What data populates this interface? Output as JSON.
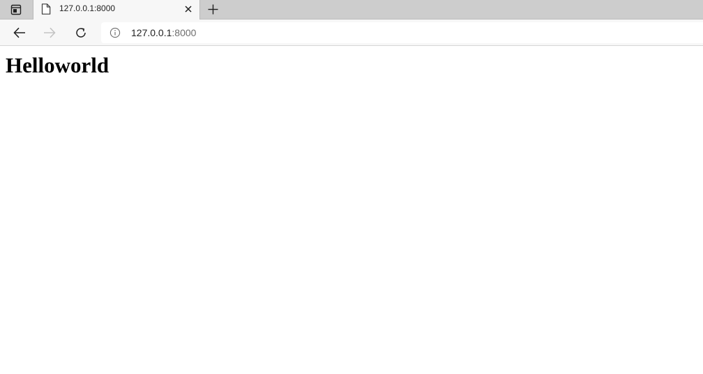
{
  "browser": {
    "tab": {
      "title": "127.0.0.1:8000",
      "favicon": "page-icon"
    },
    "tab_actions_icon": "tab-actions-icon",
    "new_tab_icon": "plus-icon",
    "close_icon": "close-icon",
    "toolbar": {
      "back_icon": "arrow-left-icon",
      "forward_icon": "arrow-right-icon",
      "forward_disabled": true,
      "reload_icon": "reload-icon"
    },
    "address_bar": {
      "site_info_icon": "info-icon",
      "host": "127.0.0.1",
      "port": ":8000"
    }
  },
  "page": {
    "heading": "Helloworld"
  },
  "colors": {
    "tabstrip": "#cdcdcd",
    "toolbar": "#f7f7f7",
    "page_background": "#ffffff",
    "text": "#000000",
    "disabled_icon": "#b5b5b5"
  }
}
